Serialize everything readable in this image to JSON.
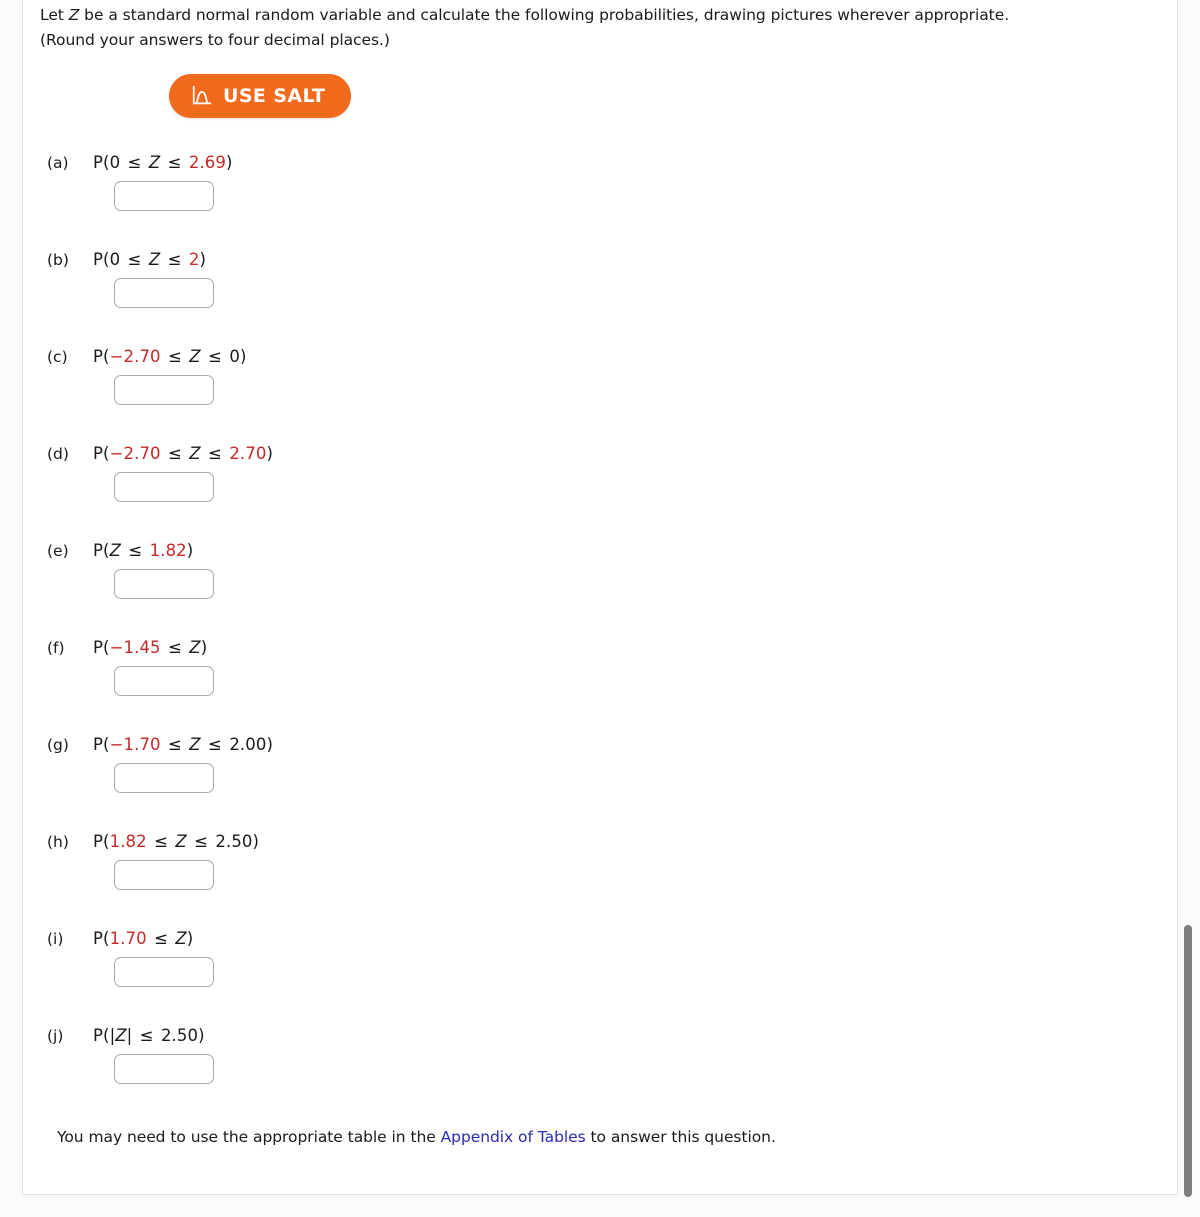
{
  "prompt": {
    "line1_a": "Let ",
    "line1_var": "Z",
    "line1_b": " be a standard normal random variable and calculate the following probabilities, drawing pictures wherever appropriate.",
    "line2": "(Round your answers to four decimal places.)"
  },
  "salt": {
    "label": "USE SALT",
    "icon": "normal-distribution-curve-icon",
    "bg_color": "#f26a1b",
    "text_color": "#ffffff"
  },
  "colors": {
    "value_red": "#c62828",
    "link_blue": "#2a2ab8",
    "text_black": "#1a1a1a",
    "input_border": "#a9a9a9",
    "panel_bg": "#ffffff",
    "page_bg": "#fbfbfb"
  },
  "questions": [
    {
      "label": "(a)",
      "expr_plain": "P(0 ≤ Z ≤ 2.69)",
      "parts": [
        {
          "t": "P(",
          "k": "paren"
        },
        {
          "t": "0",
          "k": "num-black"
        },
        {
          "t": " ≤ ",
          "k": "op"
        },
        {
          "t": "Z",
          "k": "var"
        },
        {
          "t": " ≤ ",
          "k": "op"
        },
        {
          "t": "2.69",
          "k": "num"
        },
        {
          "t": ")",
          "k": "paren"
        }
      ],
      "answer": "",
      "placeholder": ""
    },
    {
      "label": "(b)",
      "expr_plain": "P(0 ≤ Z ≤ 2)",
      "parts": [
        {
          "t": "P(",
          "k": "paren"
        },
        {
          "t": "0",
          "k": "num-black"
        },
        {
          "t": " ≤ ",
          "k": "op"
        },
        {
          "t": "Z",
          "k": "var"
        },
        {
          "t": " ≤ ",
          "k": "op"
        },
        {
          "t": "2",
          "k": "num"
        },
        {
          "t": ")",
          "k": "paren"
        }
      ],
      "answer": "",
      "placeholder": ""
    },
    {
      "label": "(c)",
      "expr_plain": "P(−2.70 ≤ Z ≤ 0)",
      "parts": [
        {
          "t": "P(",
          "k": "paren"
        },
        {
          "t": "−2.70",
          "k": "num"
        },
        {
          "t": " ≤ ",
          "k": "op"
        },
        {
          "t": "Z",
          "k": "var"
        },
        {
          "t": " ≤ ",
          "k": "op"
        },
        {
          "t": "0",
          "k": "num-black"
        },
        {
          "t": ")",
          "k": "paren"
        }
      ],
      "answer": "",
      "placeholder": ""
    },
    {
      "label": "(d)",
      "expr_plain": "P(−2.70 ≤ Z ≤ 2.70)",
      "parts": [
        {
          "t": "P(",
          "k": "paren"
        },
        {
          "t": "−2.70",
          "k": "num"
        },
        {
          "t": " ≤ ",
          "k": "op"
        },
        {
          "t": "Z",
          "k": "var"
        },
        {
          "t": " ≤ ",
          "k": "op"
        },
        {
          "t": "2.70",
          "k": "num"
        },
        {
          "t": ")",
          "k": "paren"
        }
      ],
      "answer": "",
      "placeholder": ""
    },
    {
      "label": "(e)",
      "expr_plain": "P(Z ≤ 1.82)",
      "parts": [
        {
          "t": "P(",
          "k": "paren"
        },
        {
          "t": "Z",
          "k": "var"
        },
        {
          "t": " ≤ ",
          "k": "op"
        },
        {
          "t": "1.82",
          "k": "num"
        },
        {
          "t": ")",
          "k": "paren"
        }
      ],
      "answer": "",
      "placeholder": ""
    },
    {
      "label": "(f)",
      "expr_plain": "P(−1.45 ≤ Z)",
      "parts": [
        {
          "t": "P(",
          "k": "paren"
        },
        {
          "t": "−1.45",
          "k": "num"
        },
        {
          "t": " ≤ ",
          "k": "op"
        },
        {
          "t": "Z",
          "k": "var"
        },
        {
          "t": ")",
          "k": "paren"
        }
      ],
      "answer": "",
      "placeholder": ""
    },
    {
      "label": "(g)",
      "expr_plain": "P(−1.70 ≤ Z ≤ 2.00)",
      "parts": [
        {
          "t": "P(",
          "k": "paren"
        },
        {
          "t": "−1.70",
          "k": "num"
        },
        {
          "t": " ≤ ",
          "k": "op"
        },
        {
          "t": "Z",
          "k": "var"
        },
        {
          "t": " ≤ ",
          "k": "op"
        },
        {
          "t": "2.00",
          "k": "num-black"
        },
        {
          "t": ")",
          "k": "paren"
        }
      ],
      "answer": "",
      "placeholder": ""
    },
    {
      "label": "(h)",
      "expr_plain": "P(1.82 ≤ Z ≤ 2.50)",
      "parts": [
        {
          "t": "P(",
          "k": "paren"
        },
        {
          "t": "1.82",
          "k": "num"
        },
        {
          "t": " ≤ ",
          "k": "op"
        },
        {
          "t": "Z",
          "k": "var"
        },
        {
          "t": " ≤ ",
          "k": "op"
        },
        {
          "t": "2.50",
          "k": "num-black"
        },
        {
          "t": ")",
          "k": "paren"
        }
      ],
      "answer": "",
      "placeholder": ""
    },
    {
      "label": "(i)",
      "expr_plain": "P(1.70 ≤ Z)",
      "parts": [
        {
          "t": "P(",
          "k": "paren"
        },
        {
          "t": "1.70",
          "k": "num"
        },
        {
          "t": " ≤ ",
          "k": "op"
        },
        {
          "t": "Z",
          "k": "var"
        },
        {
          "t": ")",
          "k": "paren"
        }
      ],
      "answer": "",
      "placeholder": ""
    },
    {
      "label": "(j)",
      "expr_plain": "P(|Z| ≤ 2.50)",
      "parts": [
        {
          "t": "P(|",
          "k": "paren"
        },
        {
          "t": "Z",
          "k": "var"
        },
        {
          "t": "|",
          "k": "paren"
        },
        {
          "t": " ≤ ",
          "k": "op"
        },
        {
          "t": "2.50",
          "k": "num-black"
        },
        {
          "t": ")",
          "k": "paren"
        }
      ],
      "answer": "",
      "placeholder": ""
    }
  ],
  "footer": {
    "before": "You may need to use the appropriate table in the ",
    "link": "Appendix of Tables",
    "after": " to answer this question."
  }
}
